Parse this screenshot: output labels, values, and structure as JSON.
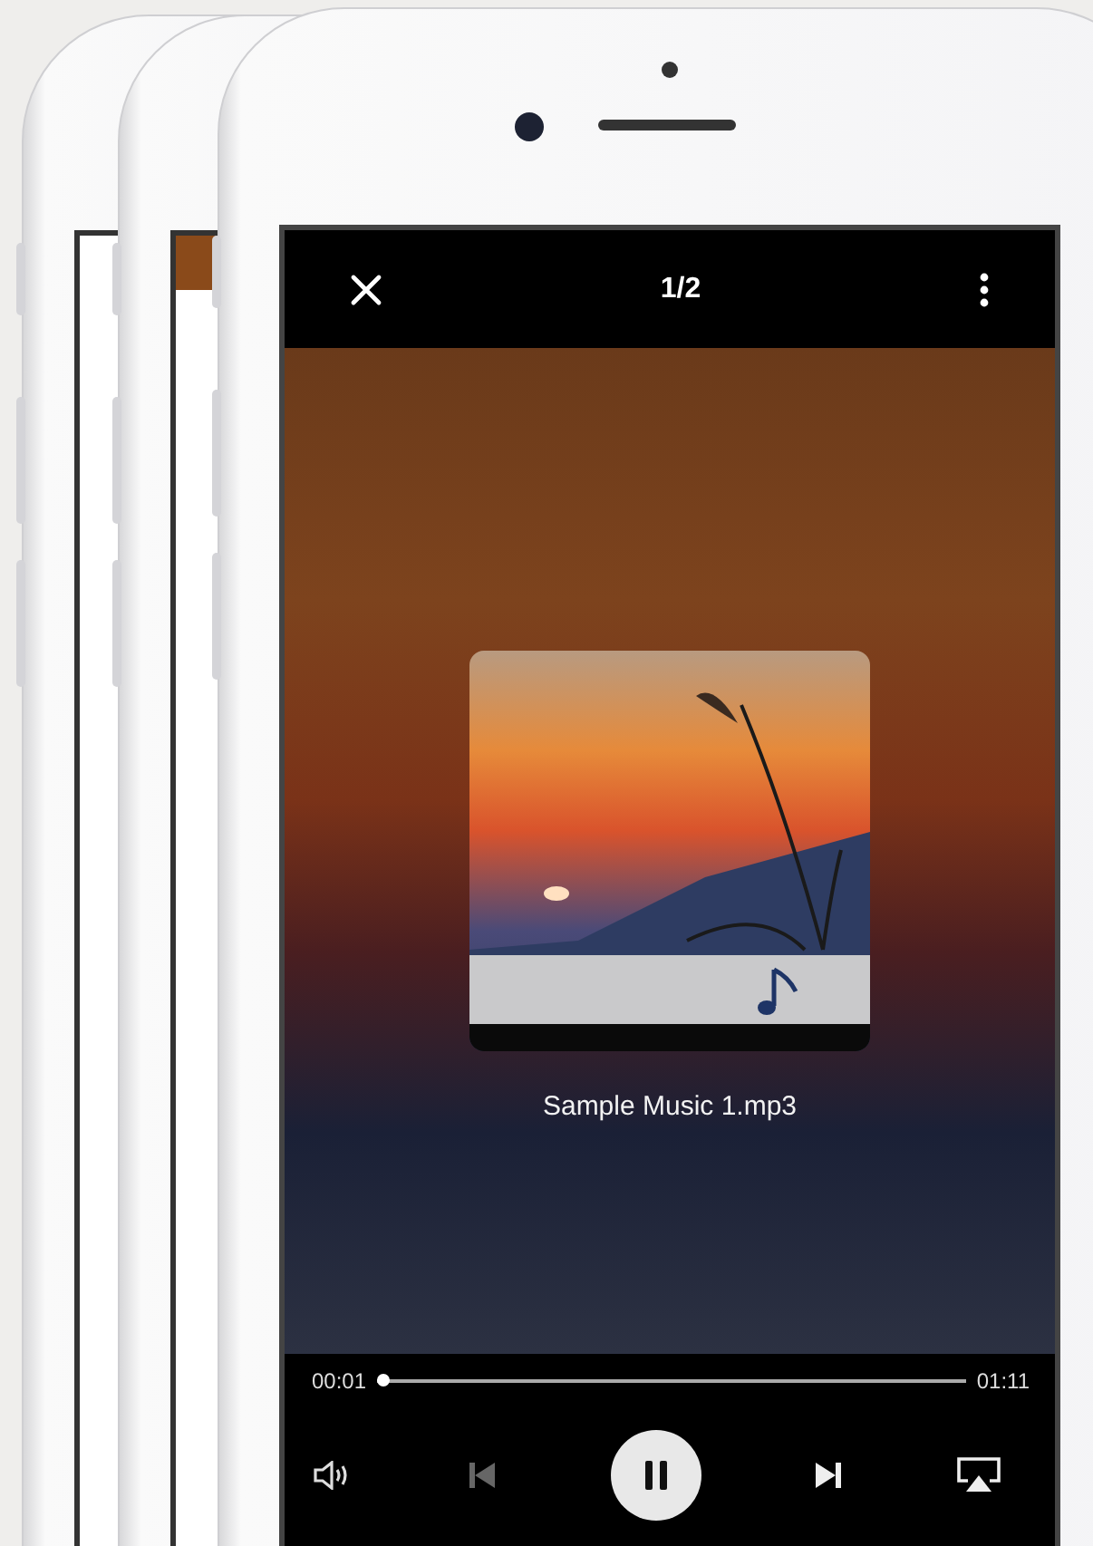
{
  "top_bar": {
    "title": "1/2"
  },
  "track": {
    "file_name": "Sample Music 1.mp3"
  },
  "progress": {
    "elapsed": "00:01",
    "duration": "01:11",
    "level": 0.01
  },
  "controls": {
    "playing": true
  }
}
